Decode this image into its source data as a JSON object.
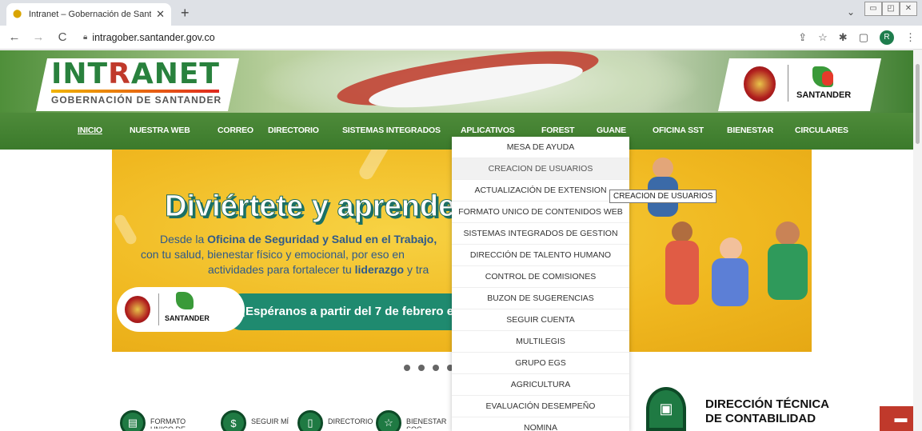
{
  "browser": {
    "tab_title": "Intranet – Gobernación de Santa",
    "tab_close": "✕",
    "new_tab": "+",
    "url": "intragober.santander.gov.co",
    "avatar_letter": "R",
    "tabs_menu": "⌄"
  },
  "header": {
    "logo_title_a": "INT",
    "logo_title_red": "R",
    "logo_title_b": "ANET",
    "logo_subtitle": "GOBERNACIÓN DE SANTANDER",
    "gov_logo_text": "SANTANDER",
    "colors": {
      "green": "#29813d",
      "red": "#c0392b",
      "nav": "#3b7a2b"
    }
  },
  "nav": {
    "items": [
      {
        "label": "INICIO"
      },
      {
        "label": "NUESTRA WEB"
      },
      {
        "label": "CORREO"
      },
      {
        "label": "DIRECTORIO"
      },
      {
        "label": "SISTEMAS INTEGRADOS"
      },
      {
        "label": "APLICATIVOS"
      },
      {
        "label": "FOREST"
      },
      {
        "label": "GUANE"
      },
      {
        "label": "OFICINA SST"
      },
      {
        "label": "BIENESTAR"
      },
      {
        "label": "CIRCULARES"
      }
    ]
  },
  "dropdown": {
    "items": [
      {
        "label": "MESA DE AYUDA"
      },
      {
        "label": "CREACION DE USUARIOS"
      },
      {
        "label": "ACTUALIZACIÓN DE EXTENSION"
      },
      {
        "label": "FORMATO UNICO DE CONTENIDOS WEB"
      },
      {
        "label": "SISTEMAS INTEGRADOS DE GESTION"
      },
      {
        "label": "DIRECCIÓN DE TALENTO HUMANO"
      },
      {
        "label": "CONTROL DE COMISIONES"
      },
      {
        "label": "BUZON DE SUGERENCIAS"
      },
      {
        "label": "SEGUIR CUENTA"
      },
      {
        "label": "MULTILEGIS"
      },
      {
        "label": "GRUPO EGS"
      },
      {
        "label": "AGRICULTURA"
      },
      {
        "label": "EVALUACIÓN DESEMPEÑO"
      },
      {
        "label": "NOMINA"
      }
    ],
    "tooltip": "CREACION DE USUARIOS"
  },
  "banner": {
    "title": "Diviértete y aprende con",
    "line1_pre": "Desde la ",
    "line1_bold": "Oficina de Seguridad y Salud en el Trabajo,",
    "line2": "con tu salud, bienestar físico y emocional, por eso en",
    "line3_pre": "actividades para fortalecer tu ",
    "line3_bold": "liderazgo",
    "line3_post": " y tra",
    "pill_text": "¡Espéranos a partir del 7 de febrero e",
    "logo_text": "SANTANDER"
  },
  "quick_links": [
    {
      "label": "FORMATO UNICO DE"
    },
    {
      "label": "SEGUIR MÍ"
    },
    {
      "label": "DIRECTORIO"
    },
    {
      "label": "BIENESTAR SOC"
    }
  ],
  "contabilidad": {
    "line1": "DIRECCIÓN TÉCNICA",
    "line2": "DE CONTABILIDAD"
  }
}
